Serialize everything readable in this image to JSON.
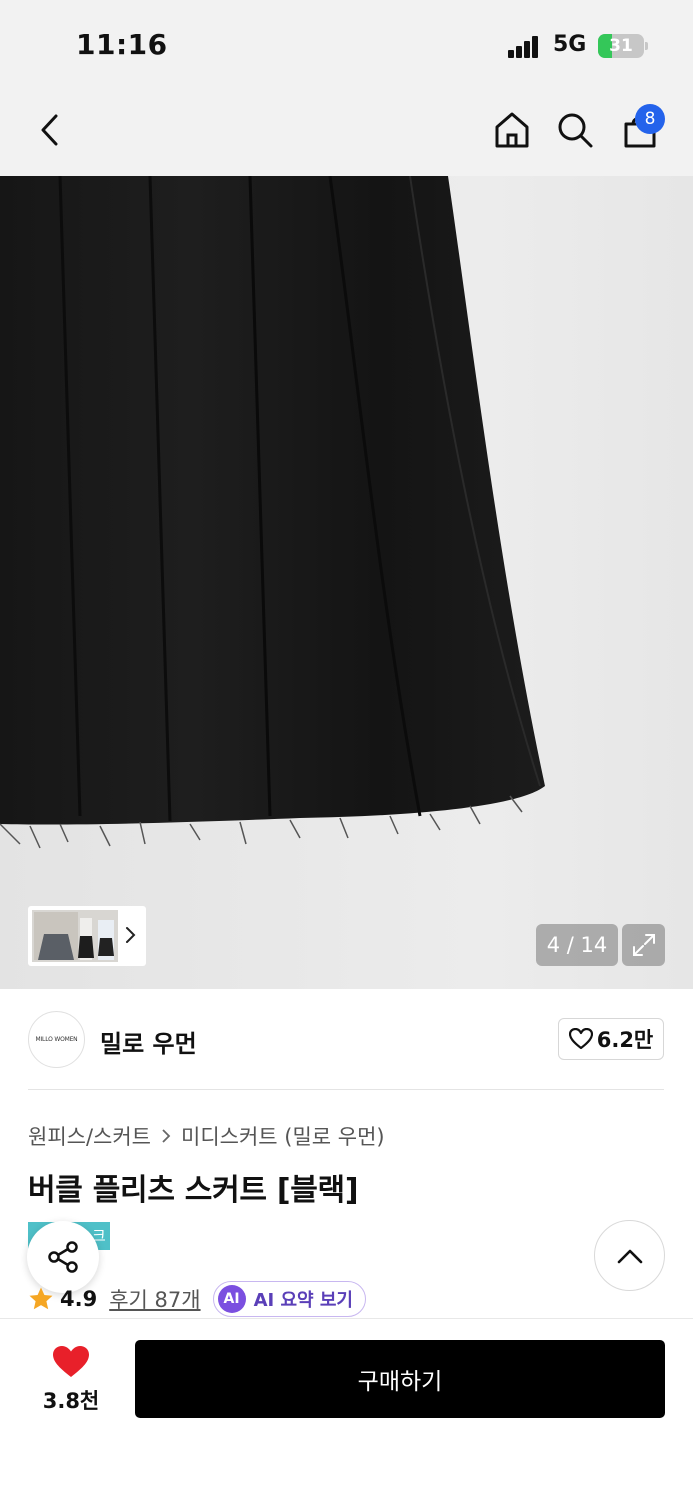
{
  "status_bar": {
    "time": "11:16",
    "network": "5G",
    "battery_level": "31",
    "battery_fraction": 0.31,
    "colors": {
      "battery": "#34c759"
    }
  },
  "nav": {
    "back_icon": "chevron-left-icon",
    "home_icon": "home-icon",
    "search_icon": "search-icon",
    "cart_icon": "shopping-bag-icon",
    "cart_count": "8",
    "colors": {
      "badge": "#2463eb"
    }
  },
  "gallery": {
    "counter": "4 / 14",
    "expand_icon": "expand-icon",
    "thumbnail_arrow_icon": "chevron-right-icon"
  },
  "brand": {
    "logo_text": "MILLO WOMEN",
    "name": "밀로 우먼",
    "like_count": "6.2만",
    "like_icon": "heart-outline-icon"
  },
  "product": {
    "breadcrumb": [
      "원피스/스커트",
      "미디스커트 (밀로 우먼)"
    ],
    "title": "버클 플리츠 스커트 [블랙]",
    "tag_partial": "크",
    "rating": "4.9",
    "reviews": "후기 87개",
    "ai_badge": "AI",
    "ai_label": "AI 요약 보기",
    "colors": {
      "tag": "#4fc0c8",
      "star": "#f5a623",
      "ai": "#7b4fe0"
    }
  },
  "floating": {
    "share_icon": "share-icon",
    "scroll_top_icon": "chevron-up-icon"
  },
  "bottom_bar": {
    "wish_count": "3.8천",
    "wish_icon": "heart-filled-icon",
    "buy_label": "구매하기",
    "colors": {
      "heart": "#e8202a",
      "buy": "#000000"
    }
  }
}
